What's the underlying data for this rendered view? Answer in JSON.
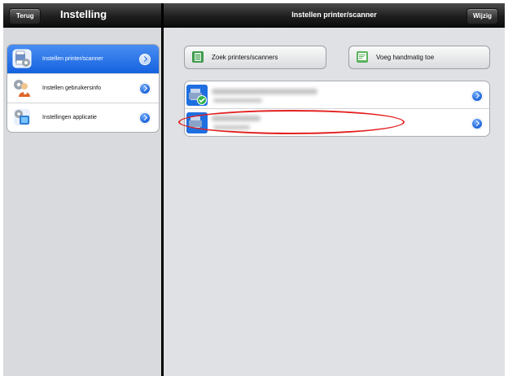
{
  "header": {
    "left": {
      "back_label": "Terug",
      "title": "Instelling"
    },
    "right": {
      "title": "Instellen printer/scanner",
      "edit_label": "Wijzig"
    }
  },
  "sidebar": {
    "items": [
      {
        "label": "Instellen printer/scanner",
        "icon": "printer-scanner-settings-icon",
        "selected": true
      },
      {
        "label": "Instellen gebruikersinfo",
        "icon": "user-info-settings-icon",
        "selected": false
      },
      {
        "label": "Instellingen applicatie",
        "icon": "application-settings-icon",
        "selected": false
      }
    ]
  },
  "main": {
    "actions": {
      "search_label": "Zoek printers/scanners",
      "add_label": "Voeg handmatig toe"
    },
    "printers": [
      {
        "status": "connected",
        "name_blurred": true
      },
      {
        "status": "available",
        "name_blurred": true
      }
    ]
  },
  "colors": {
    "selected_row": "#1562e0",
    "annotation_ellipse": "#e32020",
    "top_bar": "#1f1f1f"
  }
}
